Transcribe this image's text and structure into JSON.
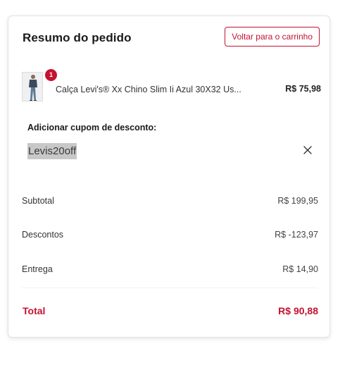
{
  "summary": {
    "title": "Resumo do pedido",
    "back_button_label": "Voltar para o carrinho"
  },
  "product": {
    "image_icon": "jeans-model-photo",
    "quantity": "1",
    "name": "Calça Levi's® Xx Chino Slim Ii Azul 30X32 Us...",
    "price": "R$ 75,98"
  },
  "coupon": {
    "label": "Adicionar cupom de desconto:",
    "code": "Levis20off",
    "remove_icon": "close-icon"
  },
  "totals": {
    "subtotal_label": "Subtotal",
    "subtotal_value": "R$ 199,95",
    "discount_label": "Descontos",
    "discount_value": "R$ -123,97",
    "shipping_label": "Entrega",
    "shipping_value": "R$ 14,90",
    "total_label": "Total",
    "total_value": "R$ 90,88"
  },
  "colors": {
    "accent": "#c41230",
    "coupon_highlight": "#c8c8c8"
  }
}
